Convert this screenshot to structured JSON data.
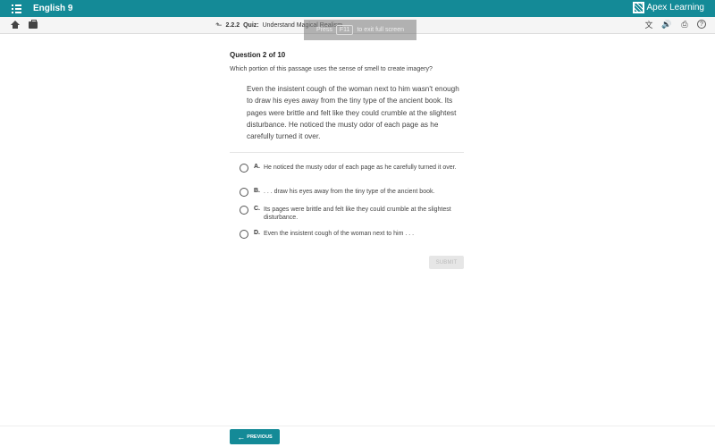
{
  "header": {
    "course_title": "English 9",
    "brand": "Apex Learning",
    "accent_color": "#148a97"
  },
  "toolbar": {
    "breadcrumb": {
      "number": "2.2.2",
      "type": "Quiz:",
      "title": "Understand Magical Realism"
    },
    "icons": [
      "home-icon",
      "briefcase-icon",
      "translate-icon",
      "read-aloud-icon",
      "print-icon",
      "help-icon"
    ]
  },
  "overlay": {
    "press": "Press",
    "key": "F11",
    "message": "to exit full screen"
  },
  "question": {
    "number_label": "Question 2 of 10",
    "prompt": "Which portion of this passage uses the sense of smell to create imagery?",
    "passage": "Even the insistent cough of the woman next to him wasn't enough to draw his eyes away from the tiny type of the ancient book. Its pages were brittle and felt like they could crumble at the slightest disturbance. He noticed the musty odor of each page as he carefully turned it over.",
    "options": [
      {
        "letter": "A.",
        "text": "He noticed the musty odor of each page as he carefully turned it over."
      },
      {
        "letter": "B.",
        "text": ". . . draw his eyes away from the tiny type of the ancient book."
      },
      {
        "letter": "C.",
        "text": "Its pages were brittle and felt like they could crumble at the slightest disturbance."
      },
      {
        "letter": "D.",
        "text": "Even the insistent cough of the woman next to him . . ."
      }
    ]
  },
  "buttons": {
    "submit": "SUBMIT",
    "previous": "PREVIOUS"
  }
}
